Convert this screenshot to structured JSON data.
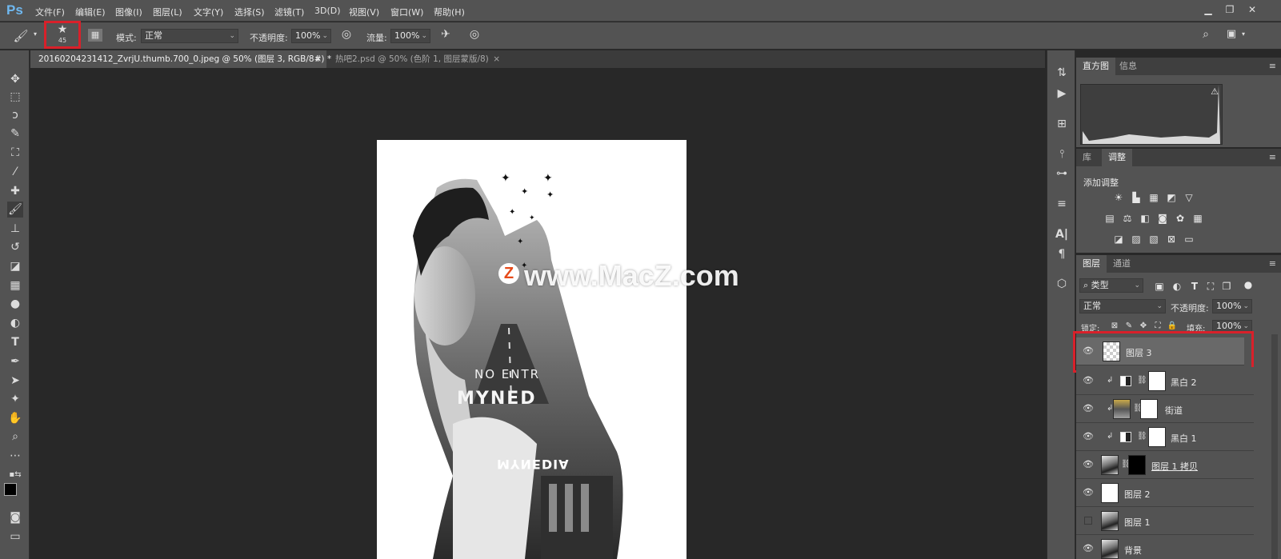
{
  "app": {
    "logo": "Ps",
    "menu": [
      "文件(F)",
      "编辑(E)",
      "图像(I)",
      "图层(L)",
      "文字(Y)",
      "选择(S)",
      "滤镜(T)",
      "3D(D)",
      "视图(V)",
      "窗口(W)",
      "帮助(H)"
    ],
    "window_controls": [
      "minimize-icon",
      "restore-icon",
      "close-icon"
    ]
  },
  "options_bar": {
    "brush_size": "45",
    "mode_label": "模式:",
    "mode_value": "正常",
    "opacity_label": "不透明度:",
    "opacity_value": "100%",
    "flow_label": "流量:",
    "flow_value": "100%"
  },
  "tabs": [
    {
      "label": "20160204231412_ZvrjU.thumb.700_0.jpeg @ 50% (图层 3, RGB/8#) *",
      "close": "×",
      "active": true
    },
    {
      "label": "热吧2.psd @ 50% (色阶 1, 图层蒙版/8)",
      "close": "×",
      "active": false
    }
  ],
  "canvas": {
    "watermark_text": "www.MacZ.com",
    "watermark_logo": "Z",
    "street_text_1": "NO ENTR",
    "street_text_2": "MYNED",
    "street_text_3": "MYNEDIA"
  },
  "panels": {
    "histogram": {
      "tabs": [
        "直方图",
        "信息"
      ],
      "warning": "⚠"
    },
    "adjustments": {
      "tabs": [
        "库",
        "调整"
      ],
      "title": "添加调整"
    },
    "layers": {
      "tabs": [
        "图层",
        "通道"
      ],
      "filter_kind": "类型",
      "blend_mode": "正常",
      "opacity_label": "不透明度:",
      "opacity_value": "100%",
      "lock_label": "锁定:",
      "fill_label": "填充:",
      "fill_value": "100%",
      "items": [
        {
          "name": "图层 3",
          "visible": true,
          "selected": true
        },
        {
          "name": "黑白 2",
          "visible": true,
          "selected": false
        },
        {
          "name": "街道",
          "visible": true,
          "selected": false
        },
        {
          "name": "黑白 1",
          "visible": true,
          "selected": false
        },
        {
          "name": "图层 1 拷贝",
          "visible": true,
          "selected": false
        },
        {
          "name": "图层 2",
          "visible": true,
          "selected": false
        },
        {
          "name": "图层 1",
          "visible": false,
          "selected": false
        },
        {
          "name": "背景",
          "visible": true,
          "selected": false
        }
      ]
    }
  },
  "colors": {
    "accent_highlight": "#d9202a",
    "ps_logo": "#6fb8f0"
  }
}
